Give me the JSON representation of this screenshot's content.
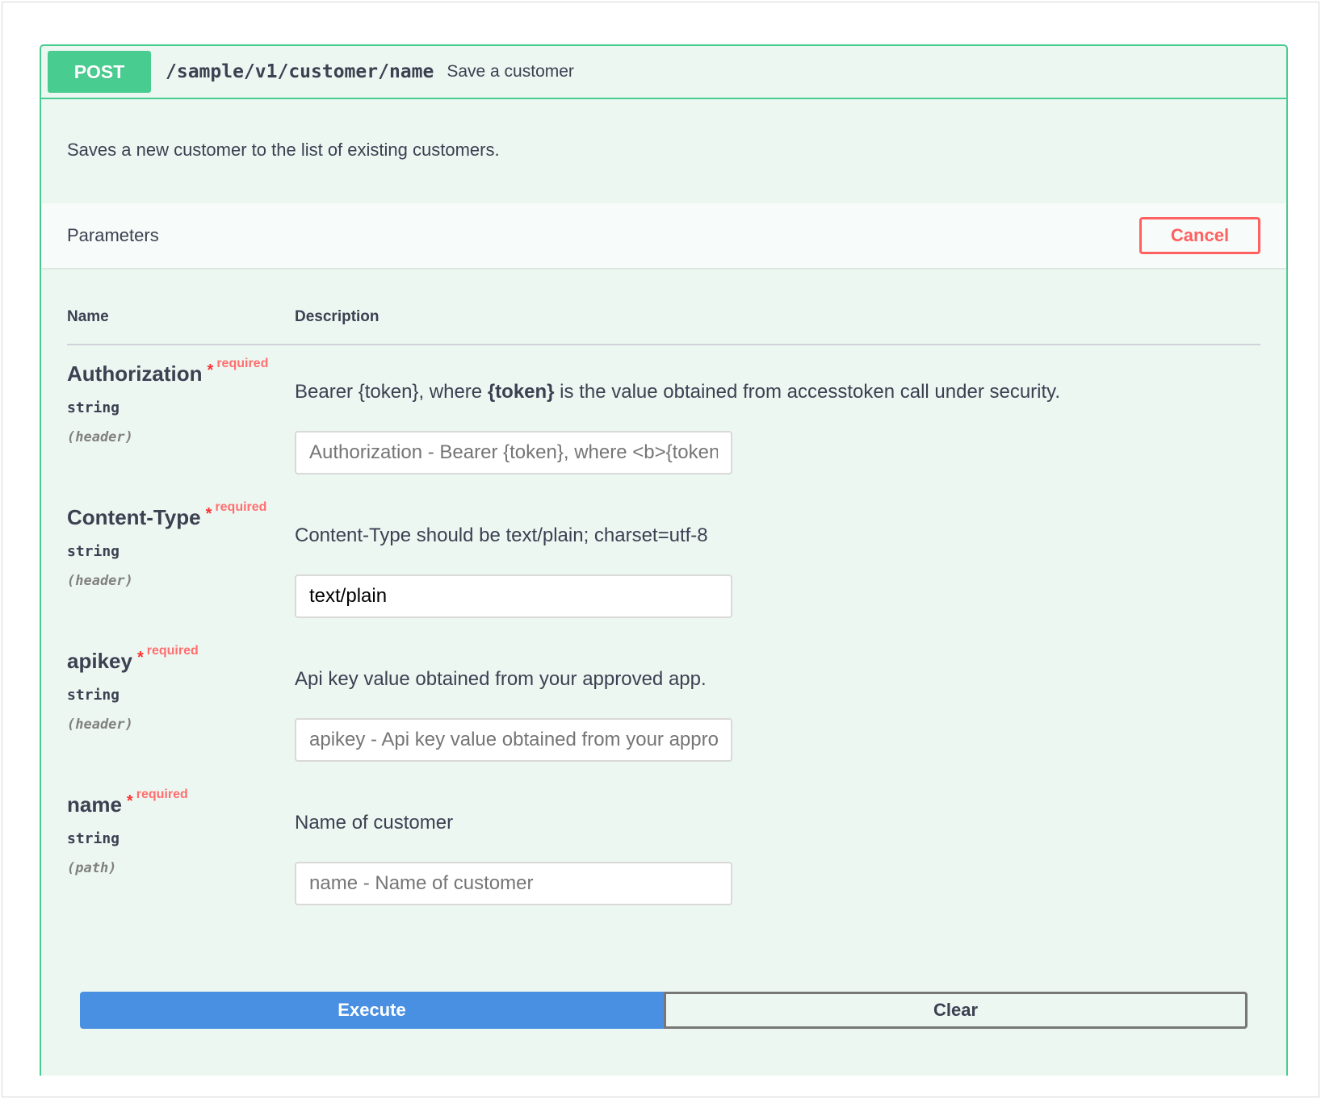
{
  "operation": {
    "method": "POST",
    "path": "/sample/v1/customer/name",
    "summary": "Save a customer",
    "description": "Saves a new customer to the list of existing customers.",
    "method_color": "#49cc90"
  },
  "parameters": {
    "title": "Parameters",
    "cancel_label": "Cancel",
    "columns": {
      "name": "Name",
      "description": "Description"
    },
    "items": [
      {
        "name": "Authorization",
        "required_star": "*",
        "required_label": "required",
        "type": "string",
        "in": "(header)",
        "description_pre": "Bearer {token}, where ",
        "description_bold": "{token}",
        "description_post": " is the value obtained from accesstoken call under security.",
        "value": "",
        "placeholder": "Authorization - Bearer {token}, where <b>{token}</b> is the value obtained from accesstoken call under security."
      },
      {
        "name": "Content-Type",
        "required_star": "*",
        "required_label": "required",
        "type": "string",
        "in": "(header)",
        "description": "Content-Type should be text/plain; charset=utf-8",
        "value": "text/plain",
        "placeholder": ""
      },
      {
        "name": "apikey",
        "required_star": "*",
        "required_label": "required",
        "type": "string",
        "in": "(header)",
        "description": "Api key value obtained from your approved app.",
        "value": "",
        "placeholder": "apikey - Api key value obtained from your approved app."
      },
      {
        "name": "name",
        "required_star": "*",
        "required_label": "required",
        "type": "string",
        "in": "(path)",
        "description": "Name of customer",
        "value": "",
        "placeholder": "name - Name of customer"
      }
    ]
  },
  "actions": {
    "execute_label": "Execute",
    "clear_label": "Clear",
    "execute_color": "#4990e2"
  }
}
